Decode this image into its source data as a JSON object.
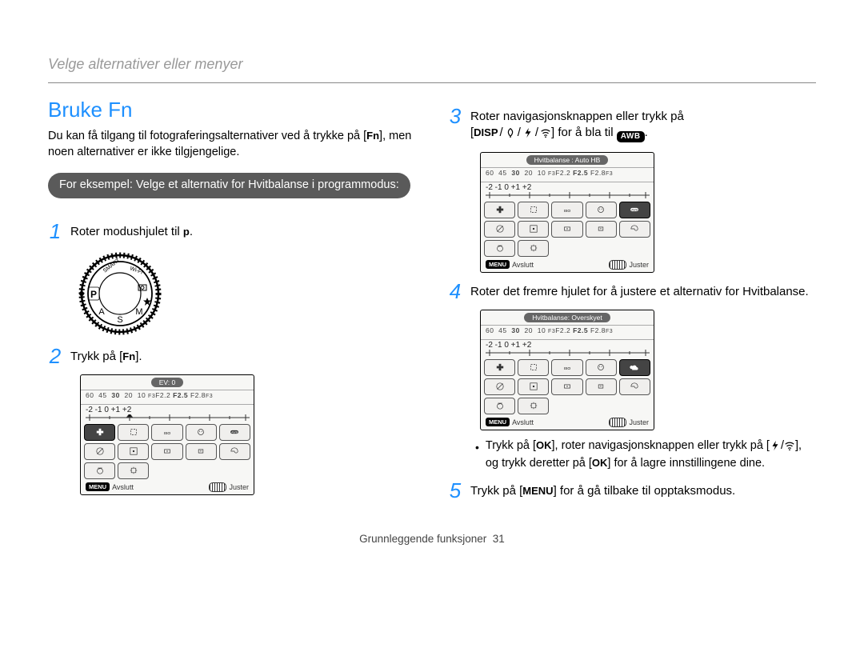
{
  "section_header": "Velge alternativer eller menyer",
  "title": "Bruke Fn",
  "intro_prefix": "Du kan få tilgang til fotograferingsalternativer ved å trykke på [",
  "intro_fn": "Fn",
  "intro_suffix": "], men noen alternativer er ikke tilgjengelige.",
  "example_pill": "For eksempel: Velge et alternativ for Hvitbalanse i programmodus:",
  "steps": {
    "s1": {
      "num": "1",
      "text_prefix": "Roter modushjulet til ",
      "mode": "p",
      "text_suffix": "."
    },
    "s2": {
      "num": "2",
      "text_prefix": "Trykk på [",
      "fn": "Fn",
      "text_suffix": "]."
    },
    "s3": {
      "num": "3",
      "line1": "Roter navigasjonsknappen eller trykk på",
      "line2_prefix": "[",
      "disp": "DISP",
      "line2_mid": "",
      "line2_suffix": "] for å bla til ",
      "awb": "AWB",
      "line2_end": "."
    },
    "s4": {
      "num": "4",
      "text": "Roter det fremre hjulet for å justere et alternativ for Hvitbalanse."
    },
    "s5": {
      "num": "5",
      "prefix": "Trykk på [",
      "menu": "MENU",
      "suffix": "] for å gå tilbake til opptaksmodus."
    }
  },
  "bullet": {
    "part1": "Trykk på [",
    "ok1": "OK",
    "part2": "], roter navigasjonsknappen eller trykk på [",
    "part3": "], og trykk deretter på [",
    "ok2": "OK",
    "part4": "] for å lagre innstillingene dine."
  },
  "lcd": {
    "ev0": "EV: 0",
    "hb_auto": "Hvitbalanse : Auto HB",
    "hb_over": "Hvitbalanse: Overskyet",
    "scale": "60  45  30  20  10 F3F2.2 F2.5 F2.8F3",
    "scale_bold1": "30",
    "scale_boldF": "F2.5",
    "evline": "-2 -1  0 +1 +2",
    "foot_exit": "Avslutt",
    "foot_adjust": "Juster",
    "menu": "MENU"
  },
  "dial": {
    "smart": "SMART",
    "wifi": "Wi-Fi",
    "p": "P",
    "a": "A",
    "s": "S",
    "m": "M"
  },
  "footer_section": "Grunnleggende funksjoner",
  "footer_page": "31"
}
